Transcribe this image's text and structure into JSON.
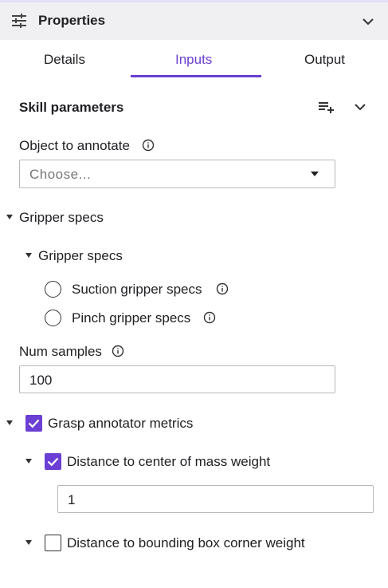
{
  "header": {
    "title": "Properties",
    "icons": {
      "settings": "tune-sliders-icon",
      "collapse": "chevron-down-icon"
    }
  },
  "tabs": [
    {
      "label": "Details",
      "active": false
    },
    {
      "label": "Inputs",
      "active": true
    },
    {
      "label": "Output",
      "active": false
    }
  ],
  "colors": {
    "accent": "#6b3fd4",
    "header_bg": "#f0f0f2",
    "text": "#202124",
    "placeholder": "#777777"
  },
  "section": {
    "title": "Skill parameters",
    "icons": [
      "playlist-add-icon",
      "chevron-down-icon"
    ]
  },
  "object_field": {
    "label": "Object to annotate",
    "placeholder": "Choose..."
  },
  "gripper": {
    "label": "Gripper specs",
    "sub_label": "Gripper specs",
    "options": [
      {
        "label": "Suction gripper specs",
        "selected": false
      },
      {
        "label": "Pinch gripper specs",
        "selected": false
      }
    ]
  },
  "num_samples": {
    "label": "Num samples",
    "value": "100"
  },
  "grasp_metrics": {
    "label": "Grasp annotator metrics",
    "checked": true,
    "items": [
      {
        "label": "Distance to center of mass weight",
        "checked": true,
        "value": "1"
      },
      {
        "label": "Distance to bounding box corner weight",
        "checked": false
      }
    ]
  }
}
